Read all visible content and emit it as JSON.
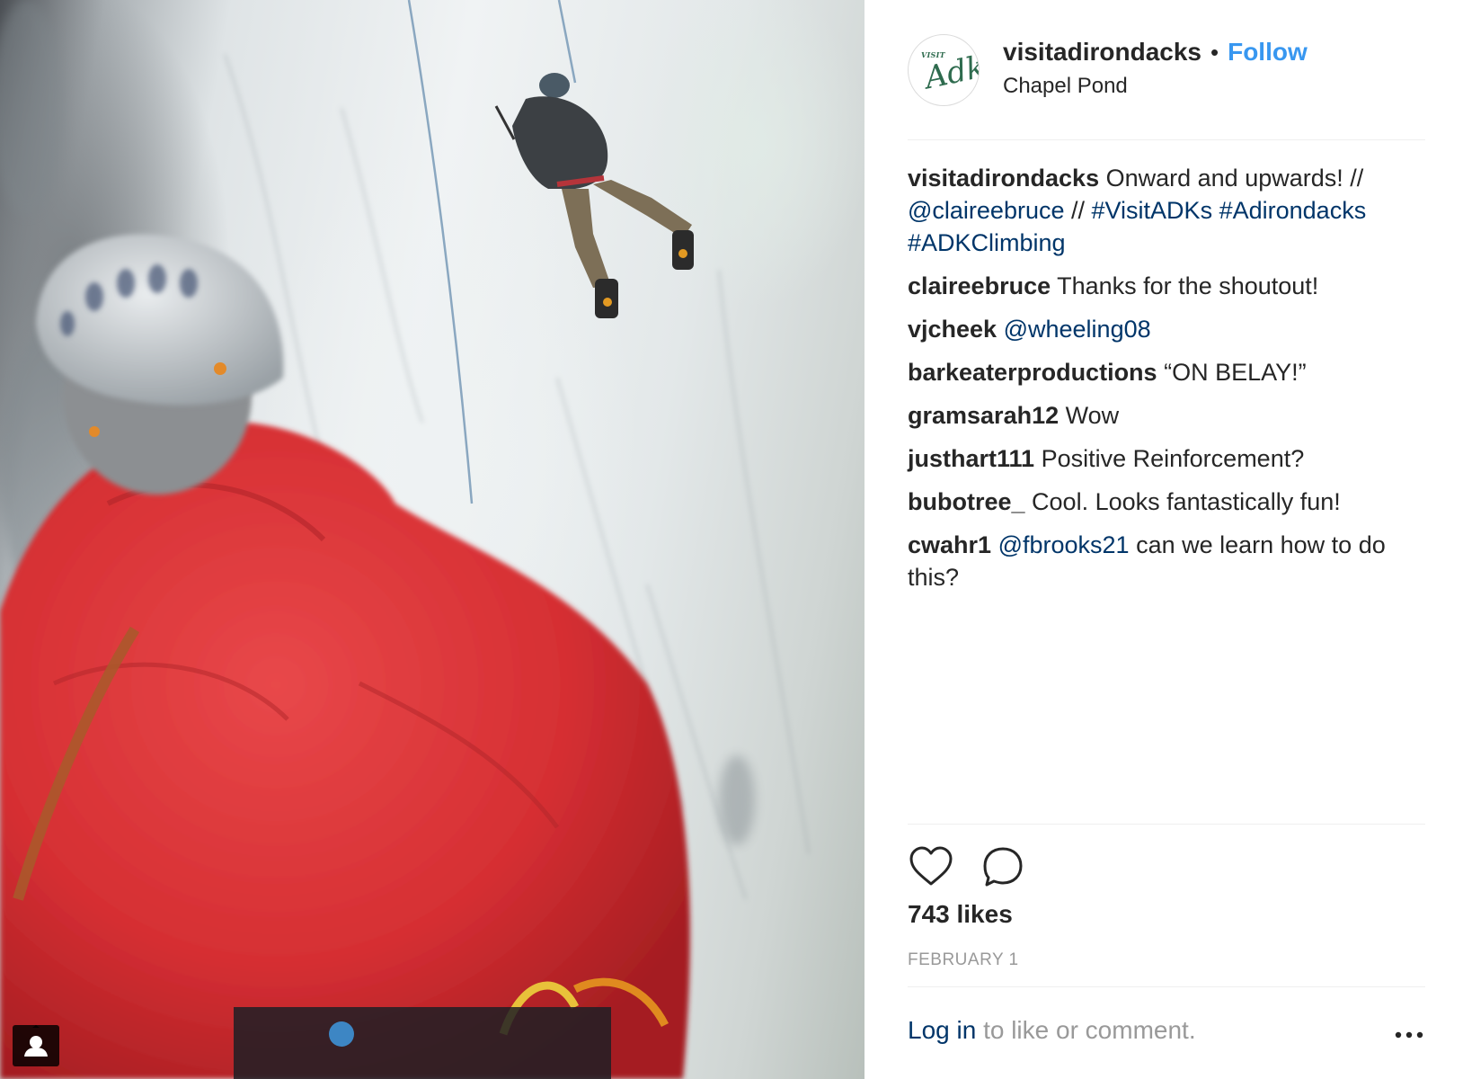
{
  "post": {
    "username": "visitadirondacks",
    "follow_label": "Follow",
    "separator": "•",
    "location": "Chapel Pond",
    "avatar_text_small": "VISIT",
    "avatar_text_large": "Adks"
  },
  "comments": [
    {
      "user": "visitadirondacks",
      "parts": [
        {
          "text": "Onward and upwards! // "
        },
        {
          "text": "@claireebruce",
          "link": true
        },
        {
          "text": " // "
        },
        {
          "text": "#VisitADKs",
          "link": true
        },
        {
          "text": " "
        },
        {
          "text": "#Adirondacks",
          "link": true
        },
        {
          "text": " "
        },
        {
          "text": "#ADKClimbing",
          "link": true
        }
      ]
    },
    {
      "user": "claireebruce",
      "parts": [
        {
          "text": "Thanks for the shoutout!"
        }
      ]
    },
    {
      "user": "vjcheek",
      "parts": [
        {
          "text": "@wheeling08",
          "link": true
        }
      ]
    },
    {
      "user": "barkeaterproductions",
      "parts": [
        {
          "text": "“ON BELAY!”"
        }
      ]
    },
    {
      "user": "gramsarah12",
      "parts": [
        {
          "text": "Wow"
        }
      ]
    },
    {
      "user": "justhart111",
      "parts": [
        {
          "text": "Positive Reinforcement?"
        }
      ]
    },
    {
      "user": "bubotree_",
      "parts": [
        {
          "text": "Cool. Looks fantastically fun!"
        }
      ]
    },
    {
      "user": "cwahr1",
      "parts": [
        {
          "text": "@fbrooks21",
          "link": true
        },
        {
          "text": " can we learn how to do this?"
        }
      ]
    }
  ],
  "actions": {
    "like_icon": "heart-outline-icon",
    "comment_icon": "speech-bubble-icon",
    "likes_text": "743 likes",
    "date": "FEBRUARY 1"
  },
  "footer": {
    "login_label": "Log in",
    "rest_text": " to like or comment.",
    "more_icon": "ellipsis-icon"
  },
  "photo": {
    "user_tag_icon": "person-tag-icon"
  },
  "colors": {
    "link": "#003569",
    "follow": "#3897f0",
    "muted": "#999999",
    "text": "#262626",
    "jacket": "#d62f33"
  }
}
